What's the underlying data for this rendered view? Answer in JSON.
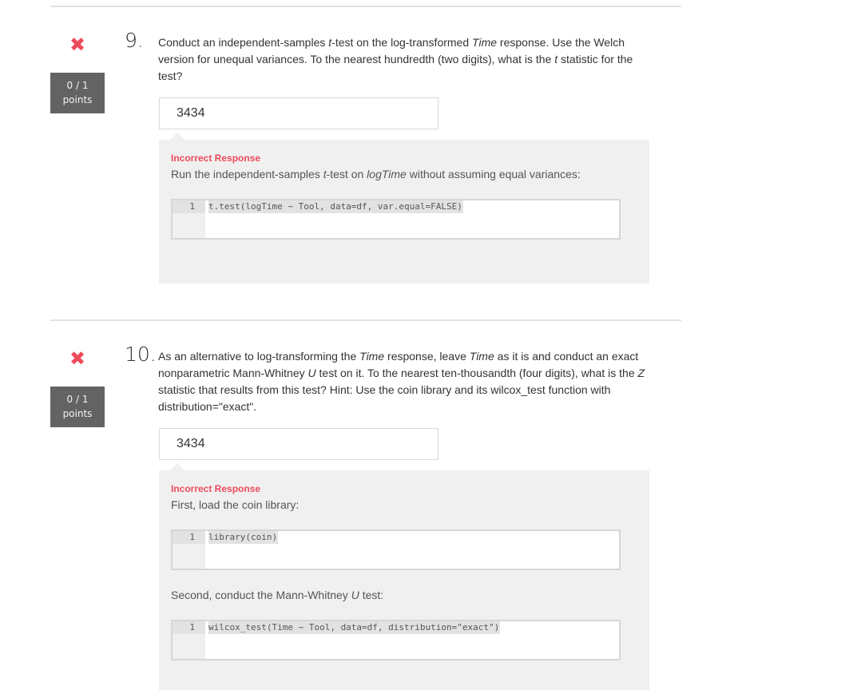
{
  "questions": [
    {
      "number": "9.",
      "status_icon": "x-mark-icon",
      "points_score": "0 / 1",
      "points_label": "points",
      "text_parts": [
        "Conduct an independent-samples ",
        "t",
        "-test on the log-transformed ",
        "Time",
        " response. Use the Welch version for unequal variances. To the nearest hundredth (two digits), what is the ",
        "t",
        " statistic for the test?"
      ],
      "answer_value": "3434",
      "feedback": {
        "title": "Incorrect Response",
        "blocks": [
          {
            "text_parts": [
              "Run the independent-samples ",
              "t",
              "-test on ",
              "logTime",
              " without assuming equal variances:"
            ],
            "code_line_number": "1",
            "code": "t.test(logTime ~ Tool, data=df, var.equal=FALSE)"
          }
        ]
      }
    },
    {
      "number": "10.",
      "status_icon": "x-mark-icon",
      "points_score": "0 / 1",
      "points_label": "points",
      "text_parts": [
        "As an alternative to log-transforming the ",
        "Time",
        " response, leave ",
        "Time",
        " as it is and conduct an exact nonparametric Mann-Whitney ",
        "U",
        " test on it. To the nearest ten-thousandth (four digits), what is the ",
        "Z",
        " statistic that results from this test? Hint: Use the coin library and its wilcox_test function with distribution=\"exact\"."
      ],
      "answer_value": "3434",
      "feedback": {
        "title": "Incorrect Response",
        "blocks": [
          {
            "text_parts": [
              "First, load the coin library:"
            ],
            "code_line_number": "1",
            "code": "library(coin)"
          },
          {
            "text_parts": [
              "Second, conduct the Mann-Whitney ",
              "U",
              " test:"
            ],
            "code_line_number": "1",
            "code": "wilcox_test(Time ~ Tool, data=df, distribution=\"exact\")"
          }
        ]
      }
    }
  ],
  "colors": {
    "incorrect": "#ee4b5b",
    "points_bg": "#636363",
    "feedback_bg": "#f0f0f0"
  }
}
